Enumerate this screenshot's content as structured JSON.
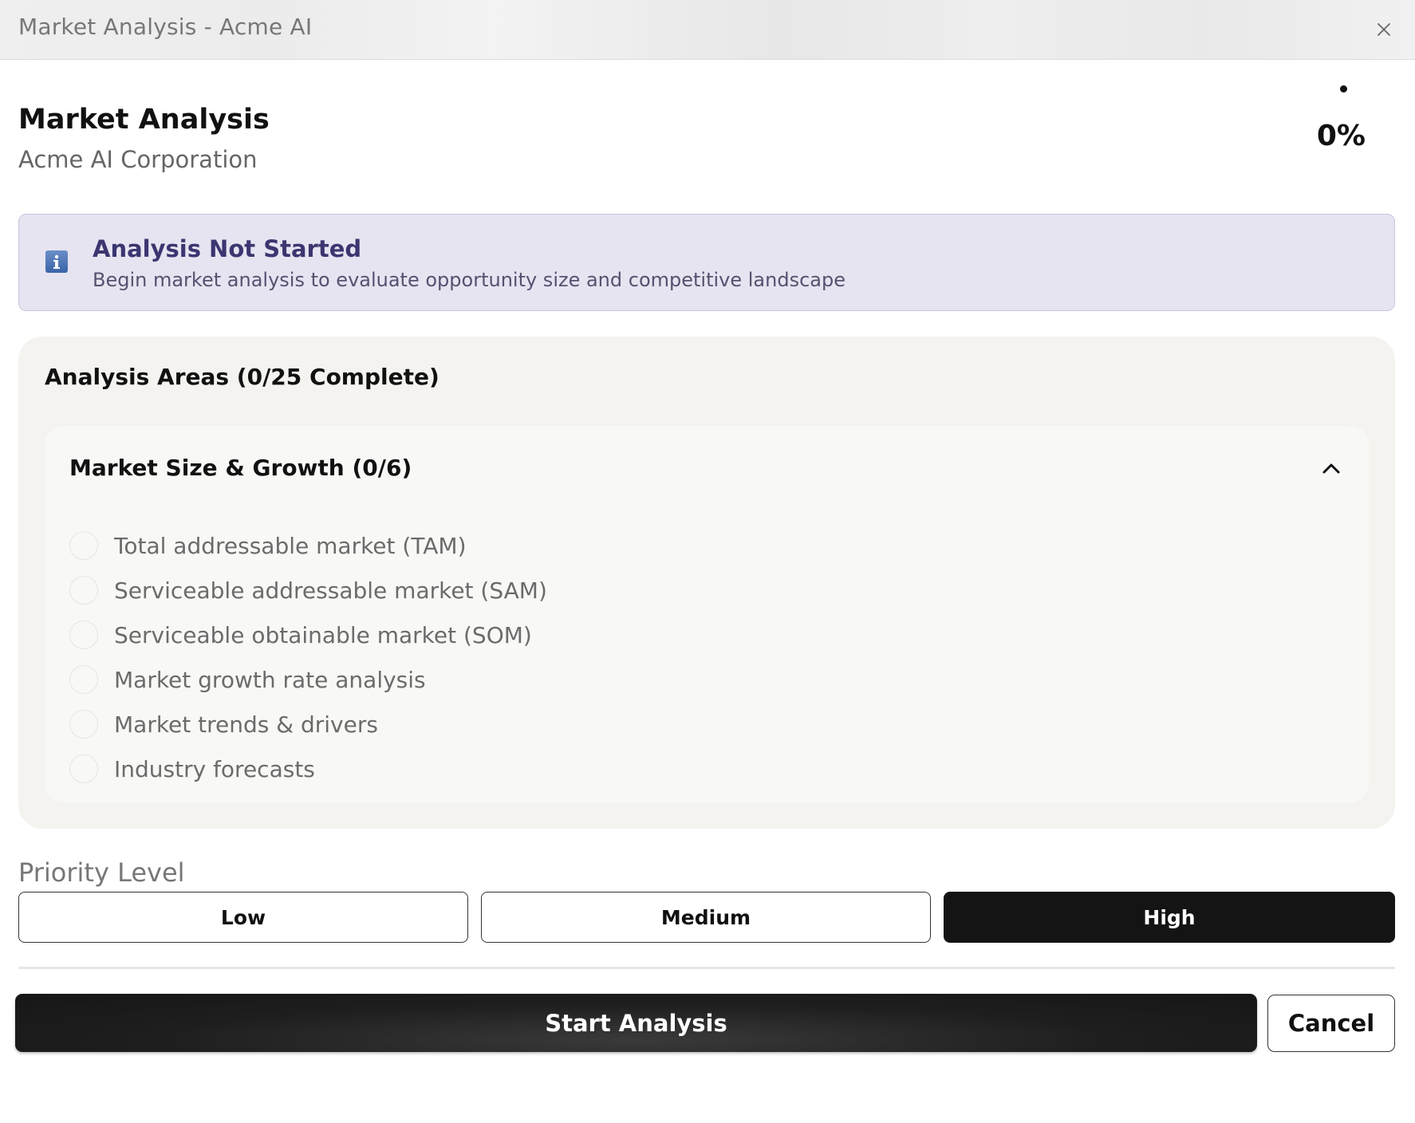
{
  "window": {
    "title": "Market Analysis - Acme AI",
    "close_icon": "close-icon"
  },
  "header": {
    "title": "Market Analysis",
    "subtitle": "Acme AI Corporation",
    "progress_percent": "0%",
    "progress_value": 0
  },
  "banner": {
    "icon": "info-icon",
    "title": "Analysis Not Started",
    "text": "Begin market analysis to evaluate opportunity size and competitive landscape",
    "accent_color": "#3b3670",
    "background_color": "#e6e4f1"
  },
  "areas": {
    "title": "Analysis Areas (0/25 Complete)",
    "sections": [
      {
        "title": "Market Size & Growth (0/6)",
        "expanded": true,
        "chevron_icon": "chevron-up-icon",
        "items": [
          {
            "label": "Total addressable market (TAM)",
            "checked": false
          },
          {
            "label": "Serviceable addressable market (SAM)",
            "checked": false
          },
          {
            "label": "Serviceable obtainable market (SOM)",
            "checked": false
          },
          {
            "label": "Market growth rate analysis",
            "checked": false
          },
          {
            "label": "Market trends & drivers",
            "checked": false
          },
          {
            "label": "Industry forecasts",
            "checked": false
          }
        ]
      }
    ]
  },
  "priority": {
    "label": "Priority Level",
    "options": [
      "Low",
      "Medium",
      "High"
    ],
    "selected": "High"
  },
  "actions": {
    "start_label": "Start Analysis",
    "cancel_label": "Cancel"
  }
}
